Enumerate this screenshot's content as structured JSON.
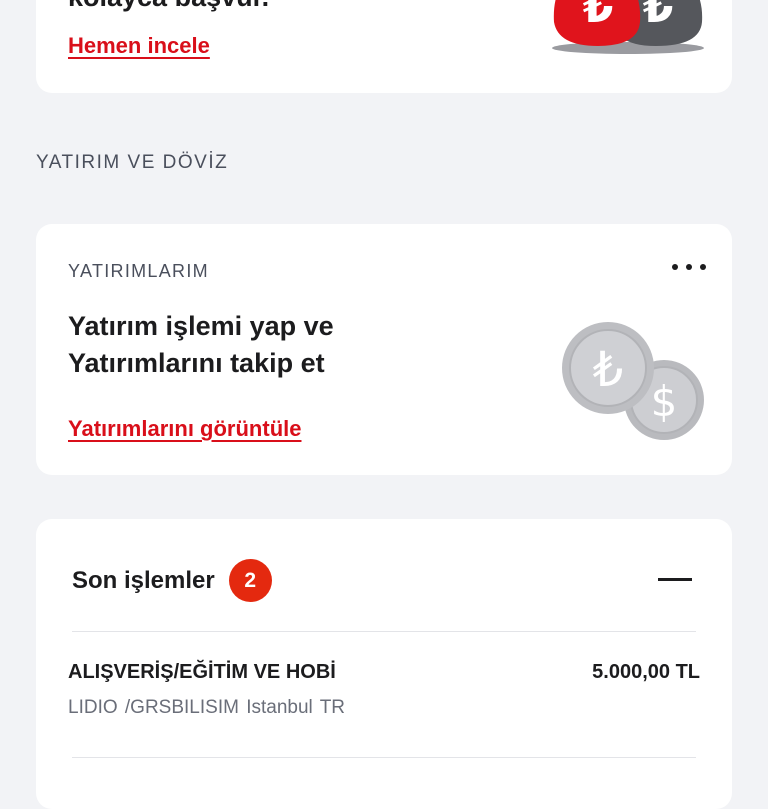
{
  "promo": {
    "title": "kolayca başvur.",
    "link": "Hemen incele"
  },
  "section": {
    "title": "YATIRIM VE DÖVİZ"
  },
  "investments": {
    "overline": "YATIRIMLARIM",
    "heading_line1": "Yatırım işlemi yap ve",
    "heading_line2": "Yatırımlarını takip et",
    "link": "Yatırımlarını görüntüle"
  },
  "transactions": {
    "title": "Son işlemler",
    "count": "2",
    "items": [
      {
        "category": "ALIŞVERİŞ/EĞİTİM VE HOBİ",
        "amount": "5.000,00 TL",
        "description": "LIDIO  /GRSBILISIM      Istanbul     TR"
      }
    ]
  },
  "colors": {
    "accent_red": "#d90f1a",
    "badge_red": "#e4290f",
    "background": "#f2f3f6",
    "card": "#ffffff"
  },
  "icons": [
    "money-bags-icon",
    "coins-icon",
    "more-options-icon",
    "collapse-icon"
  ]
}
